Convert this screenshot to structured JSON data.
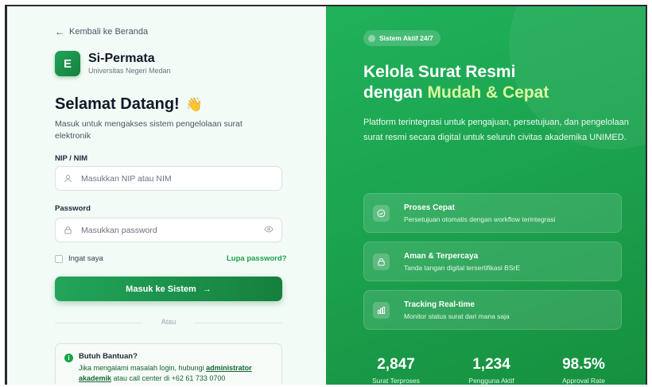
{
  "back_link": {
    "label": "Kembali ke Beranda"
  },
  "brand": {
    "logo_letter": "E",
    "name": "Si-Permata",
    "subtitle": "Universitas Negeri Medan"
  },
  "welcome": {
    "title": "Selamat Datang!",
    "emoji": "👋",
    "description": "Masuk untuk mengakses sistem pengelolaan surat elektronik"
  },
  "form": {
    "nip_label": "NIP / NIM",
    "nip_placeholder": "Masukkan NIP atau NIM",
    "password_label": "Password",
    "password_placeholder": "Masukkan password",
    "remember_label": "Ingat saya",
    "forgot_label": "Lupa password?",
    "submit_label": "Masuk ke Sistem",
    "submit_arrow": "→",
    "divider_label": "Atau"
  },
  "help": {
    "icon": "i",
    "title": "Butuh Bantuan?",
    "text_before": "Jika mengalami masalah login, hubungi ",
    "link": "administrator akademik",
    "text_after": " atau call center di +62 61 733 0700"
  },
  "hero": {
    "status_label": "Sistem Aktif 24/7",
    "headline_line1": "Kelola Surat Resmi",
    "headline_line2_prefix": "dengan ",
    "headline_accent": "Mudah & Cepat",
    "description": "Platform terintegrasi untuk pengajuan, persetujuan, dan pengelolaan surat resmi secara digital untuk seluruh civitas akademika UNIMED."
  },
  "features": [
    {
      "icon": "check-circle-icon",
      "title": "Proses Cepat",
      "desc": "Persetujuan otomatis dengan workflow terintegrasi"
    },
    {
      "icon": "lock-icon",
      "title": "Aman & Terpercaya",
      "desc": "Tanda tangan digital tersertifikasi BSrE"
    },
    {
      "icon": "bar-chart-icon",
      "title": "Tracking Real-time",
      "desc": "Monitor status surat dari mana saja"
    }
  ],
  "stats": [
    {
      "value": "2,847",
      "label": "Surat Terproses"
    },
    {
      "value": "1,234",
      "label": "Pengguna Aktif"
    },
    {
      "value": "98.5%",
      "label": "Approval Rate"
    }
  ],
  "colors": {
    "primary": "#16a34a",
    "accent": "#d9f99d",
    "panel_bg": "#f3fbf6"
  }
}
